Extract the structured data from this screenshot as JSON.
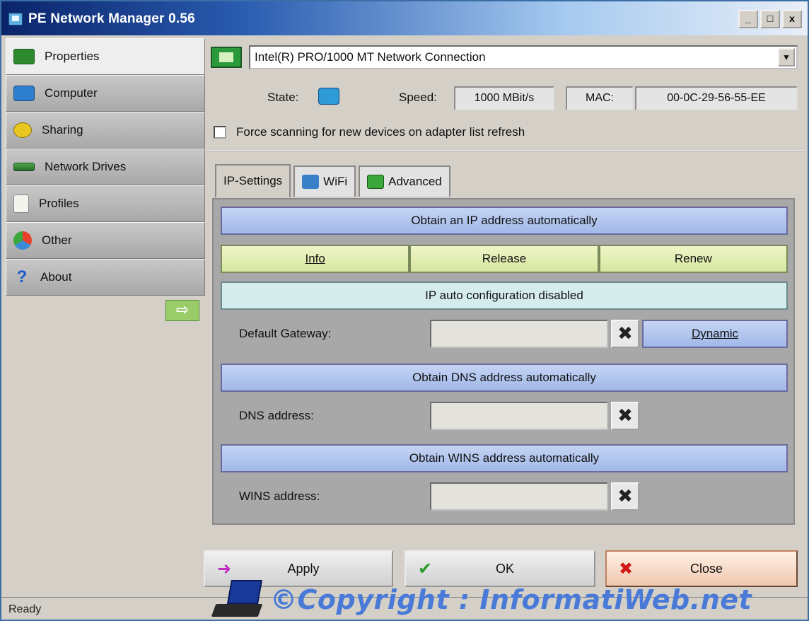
{
  "window": {
    "title": "PE Network Manager 0.56",
    "min_label": "_",
    "max_label": "□",
    "close_label": "x"
  },
  "sidebar": {
    "items": [
      {
        "label": "Properties",
        "icon": "network-card-icon"
      },
      {
        "label": "Computer",
        "icon": "computer-icon"
      },
      {
        "label": "Sharing",
        "icon": "sharing-icon"
      },
      {
        "label": "Network Drives",
        "icon": "network-drive-icon"
      },
      {
        "label": "Profiles",
        "icon": "profile-icon"
      },
      {
        "label": "Other",
        "icon": "other-icon"
      },
      {
        "label": "About",
        "icon": "help-icon"
      }
    ],
    "about_glyph": "?",
    "arrow_glyph": "⇨"
  },
  "adapter": {
    "selected": "Intel(R) PRO/1000 MT Network Connection",
    "dropdown_glyph": "▼"
  },
  "status_row": {
    "state_label": "State:",
    "speed_label": "Speed:",
    "speed_value": "1000 MBit/s",
    "mac_label": "MAC:",
    "mac_value": "00-0C-29-56-55-EE"
  },
  "force_scan": {
    "label": "Force scanning for new devices on adapter list refresh",
    "checked": false
  },
  "tabs": [
    {
      "label": "IP-Settings",
      "active": true
    },
    {
      "label": "WiFi",
      "active": false
    },
    {
      "label": "Advanced",
      "active": false
    }
  ],
  "ip_settings": {
    "obtain_ip": "Obtain an IP address automatically",
    "info": "Info",
    "release": "Release",
    "renew": "Renew",
    "auto_config": "IP auto configuration disabled",
    "gateway_label": "Default Gateway:",
    "gateway_value": "",
    "dynamic": "Dynamic",
    "obtain_dns": "Obtain DNS address automatically",
    "dns_label": "DNS address:",
    "dns_value": "",
    "obtain_wins": "Obtain WINS address automatically",
    "wins_label": "WINS address:",
    "wins_value": "",
    "clear_glyph": "✖"
  },
  "buttons": {
    "apply": "Apply",
    "apply_glyph": "➜",
    "ok": "OK",
    "ok_glyph": "✔",
    "close": "Close",
    "close_glyph": "✖"
  },
  "statusbar": {
    "text": "Ready"
  },
  "watermark": {
    "text": "©Copyright : InformatiWeb.net"
  },
  "colors": {
    "titlebar_start": "#0a246a",
    "bar_blue": "#a2b8e8",
    "bar_green": "#d6e6a0",
    "watermark": "#4a7ad8"
  }
}
